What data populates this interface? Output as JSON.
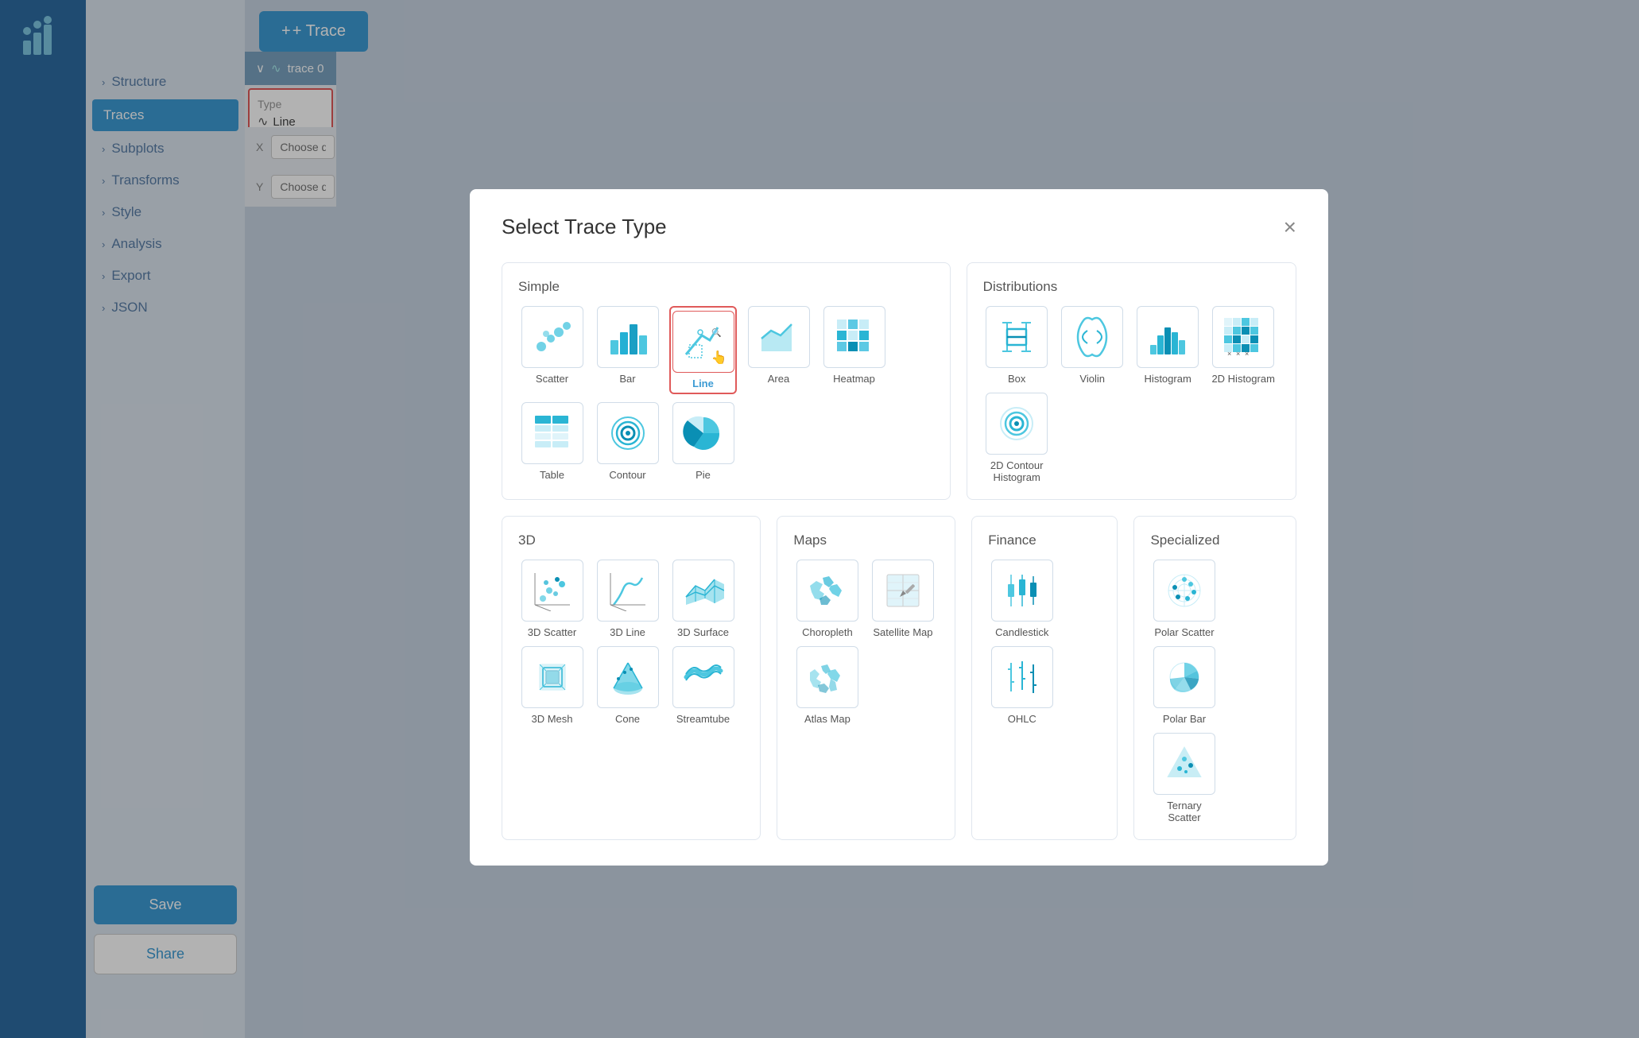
{
  "app": {
    "logo_alt": "Plotly logo",
    "add_trace_label": "+ Trace"
  },
  "sidebar": {
    "items": [
      {
        "id": "structure",
        "label": "Structure",
        "active": false,
        "arrow": "›"
      },
      {
        "id": "traces",
        "label": "Traces",
        "active": true,
        "arrow": ""
      },
      {
        "id": "subplots",
        "label": "Subplots",
        "active": false,
        "arrow": "›"
      },
      {
        "id": "transforms",
        "label": "Transforms",
        "active": false,
        "arrow": "›"
      },
      {
        "id": "style",
        "label": "Style",
        "active": false,
        "arrow": "›"
      },
      {
        "id": "analysis",
        "label": "Analysis",
        "active": false,
        "arrow": "›"
      },
      {
        "id": "export",
        "label": "Export",
        "active": false,
        "arrow": "›"
      },
      {
        "id": "json",
        "label": "JSON",
        "active": false,
        "arrow": "›"
      }
    ],
    "save_label": "Save",
    "share_label": "Share"
  },
  "trace_panel": {
    "trace_name": "trace 0",
    "type_label": "Type",
    "type_value": "Line",
    "x_label": "X",
    "y_label": "Y",
    "x_placeholder": "Choose data...",
    "y_placeholder": "Choose data..."
  },
  "modal": {
    "title": "Select Trace Type",
    "close_label": "×",
    "sections": {
      "simple": {
        "title": "Simple",
        "items": [
          {
            "id": "scatter",
            "label": "Scatter",
            "selected": false
          },
          {
            "id": "bar",
            "label": "Bar",
            "selected": false
          },
          {
            "id": "line",
            "label": "Line",
            "selected": true
          },
          {
            "id": "area",
            "label": "Area",
            "selected": false
          },
          {
            "id": "heatmap",
            "label": "Heatmap",
            "selected": false
          },
          {
            "id": "table",
            "label": "Table",
            "selected": false
          },
          {
            "id": "contour",
            "label": "Contour",
            "selected": false
          },
          {
            "id": "pie",
            "label": "Pie",
            "selected": false
          }
        ]
      },
      "distributions": {
        "title": "Distributions",
        "items": [
          {
            "id": "box",
            "label": "Box",
            "selected": false
          },
          {
            "id": "violin",
            "label": "Violin",
            "selected": false
          },
          {
            "id": "histogram",
            "label": "Histogram",
            "selected": false
          },
          {
            "id": "2d-histogram",
            "label": "2D Histogram",
            "selected": false
          },
          {
            "id": "2d-contour-histogram",
            "label": "2D Contour Histogram",
            "selected": false
          }
        ]
      },
      "three_d": {
        "title": "3D",
        "items": [
          {
            "id": "3d-scatter",
            "label": "3D Scatter",
            "selected": false
          },
          {
            "id": "3d-line",
            "label": "3D Line",
            "selected": false
          },
          {
            "id": "3d-surface",
            "label": "3D Surface",
            "selected": false
          },
          {
            "id": "3d-mesh",
            "label": "3D Mesh",
            "selected": false
          },
          {
            "id": "cone",
            "label": "Cone",
            "selected": false
          },
          {
            "id": "streamtube",
            "label": "Streamtube",
            "selected": false
          }
        ]
      },
      "maps": {
        "title": "Maps",
        "items": [
          {
            "id": "choropleth",
            "label": "Choropleth",
            "selected": false
          },
          {
            "id": "satellite-map",
            "label": "Satellite Map",
            "selected": false
          },
          {
            "id": "atlas-map",
            "label": "Atlas Map",
            "selected": false
          }
        ]
      },
      "finance": {
        "title": "Finance",
        "items": [
          {
            "id": "candlestick",
            "label": "Candlestick",
            "selected": false
          },
          {
            "id": "ohlc",
            "label": "OHLC",
            "selected": false
          }
        ]
      },
      "specialized": {
        "title": "Specialized",
        "items": [
          {
            "id": "polar-scatter",
            "label": "Polar Scatter",
            "selected": false
          },
          {
            "id": "polar-bar",
            "label": "Polar Bar",
            "selected": false
          },
          {
            "id": "ternary-scatter",
            "label": "Ternary Scatter",
            "selected": false
          }
        ]
      }
    }
  }
}
